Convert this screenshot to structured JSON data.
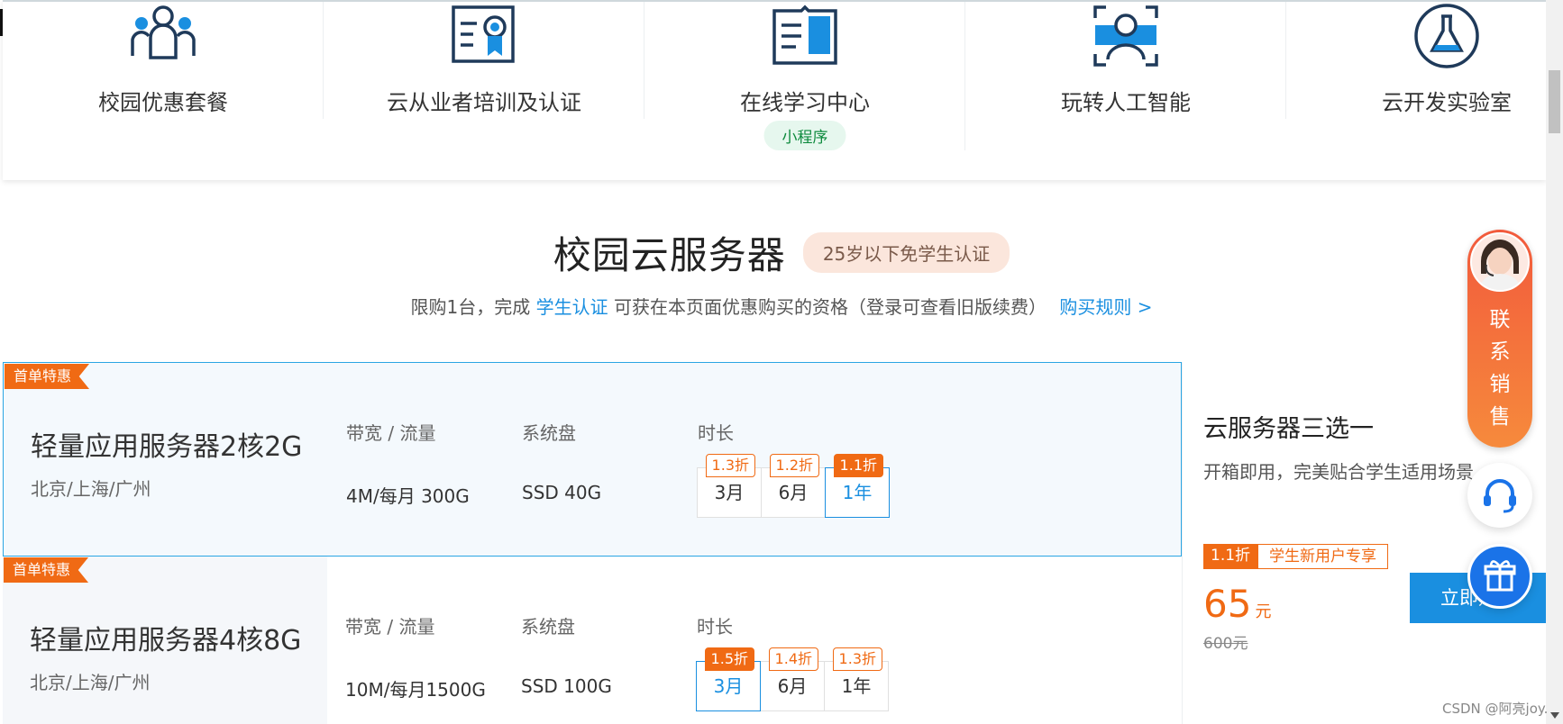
{
  "nav": {
    "items": [
      {
        "label": "校园优惠套餐",
        "icon": "users-group-icon"
      },
      {
        "label": "云从业者培训及认证",
        "icon": "certificate-icon"
      },
      {
        "label": "在线学习中心",
        "icon": "book-icon",
        "badge": "小程序"
      },
      {
        "label": "玩转人工智能",
        "icon": "ai-face-icon"
      },
      {
        "label": "云开发实验室",
        "icon": "flask-icon"
      }
    ]
  },
  "section": {
    "title": "校园云服务器",
    "age_badge": "25岁以下免学生认证",
    "sub_prefix": "限购1台，完成 ",
    "sub_link": "学生认证",
    "sub_middle": " 可获在本页面优惠购买的资格（登录可查看旧版续费）",
    "sub_rules": "购买规则 >"
  },
  "column_headers": {
    "bandwidth": "带宽 / 流量",
    "disk": "系统盘",
    "duration": "时长"
  },
  "products": [
    {
      "ribbon": "首单特惠",
      "name": "轻量应用服务器2核2G",
      "region": "北京/上海/广州",
      "bandwidth": "4M/每月 300G",
      "disk": "SSD 40G",
      "durations": [
        {
          "label": "3月",
          "discount": "1.3折",
          "selected": false,
          "hot": false
        },
        {
          "label": "6月",
          "discount": "1.2折",
          "selected": false,
          "hot": false
        },
        {
          "label": "1年",
          "discount": "1.1折",
          "selected": true,
          "hot": true
        }
      ]
    },
    {
      "ribbon": "首单特惠",
      "name": "轻量应用服务器4核8G",
      "region": "北京/上海/广州",
      "bandwidth": "10M/每月1500G",
      "disk": "SSD 100G",
      "durations": [
        {
          "label": "3月",
          "discount": "1.5折",
          "selected": true,
          "hot": true
        },
        {
          "label": "6月",
          "discount": "1.4折",
          "selected": false,
          "hot": false
        },
        {
          "label": "1年",
          "discount": "1.3折",
          "selected": false,
          "hot": false
        }
      ]
    }
  ],
  "right_panel": {
    "title": "云服务器三选一",
    "desc": "开箱即用，完美贴合学生适用场景",
    "tag_discount": "1.1折",
    "tag_text": "学生新用户专享",
    "price": "65",
    "price_unit": "元",
    "old_price": "600元",
    "buy_label": "立即购买"
  },
  "floating": {
    "contact_label": "联系销售"
  },
  "watermark": "CSDN @阿亮joy.",
  "colors": {
    "accent_blue": "#1a8fe0",
    "accent_orange": "#f06a14"
  }
}
